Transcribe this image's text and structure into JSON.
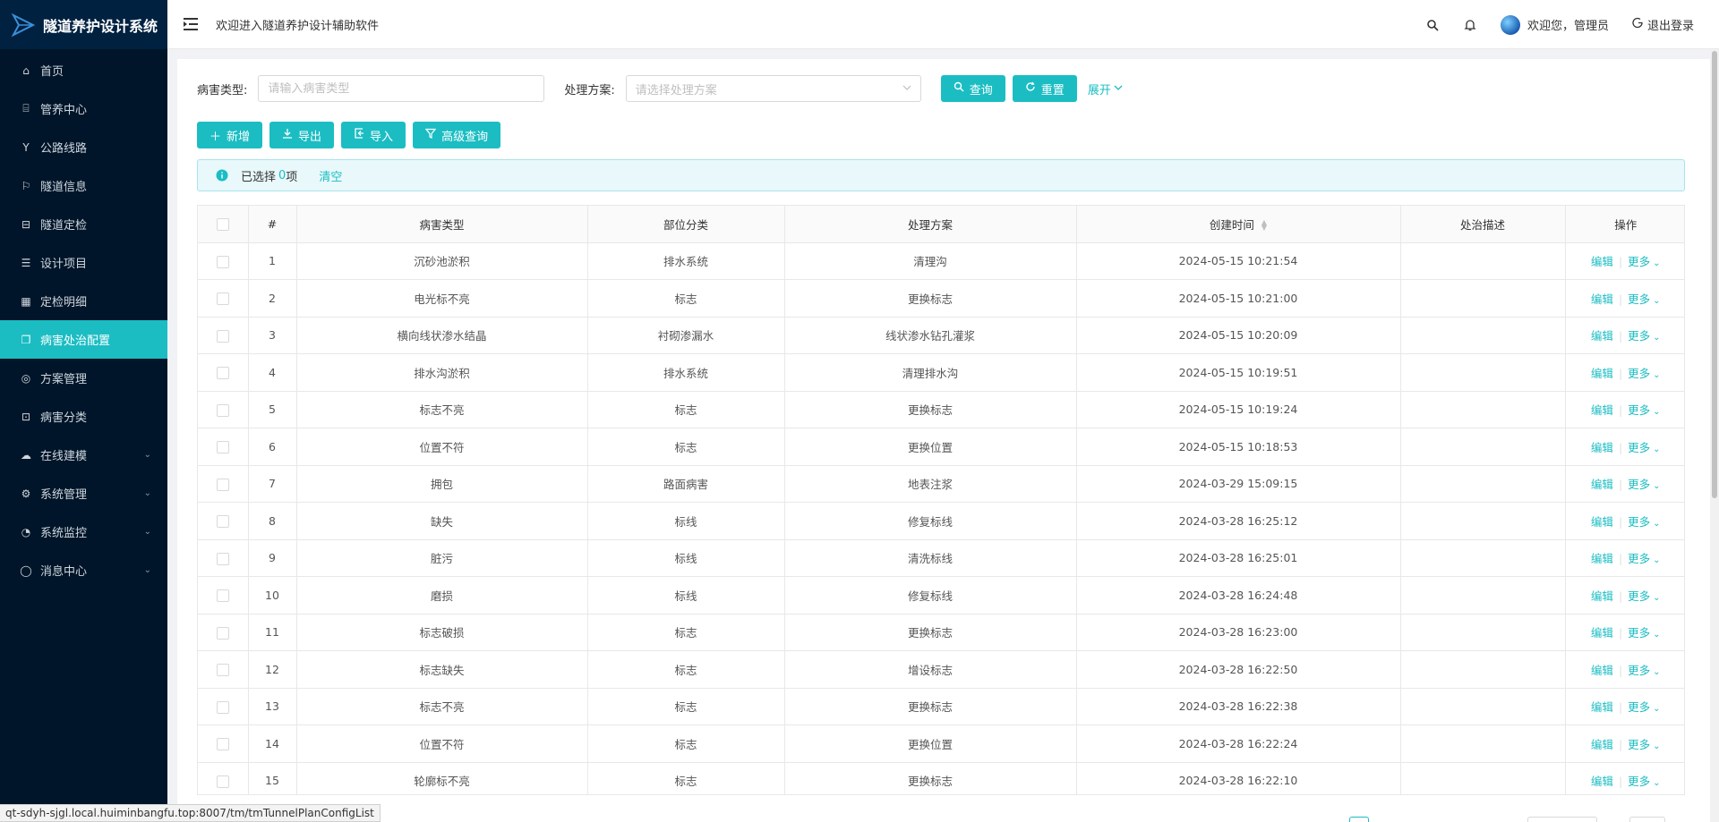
{
  "app": {
    "title": "隧道养护设计系统",
    "welcome": "欢迎进入隧道养护设计辅助软件"
  },
  "colors": {
    "accent": "#1bbdc3",
    "sidebar_bg": "#001529"
  },
  "sidebar": {
    "items": [
      {
        "label": "首页",
        "icon": "home-icon"
      },
      {
        "label": "管养中心",
        "icon": "bank-icon"
      },
      {
        "label": "公路线路",
        "icon": "fork-icon"
      },
      {
        "label": "隧道信息",
        "icon": "flag-icon"
      },
      {
        "label": "隧道定检",
        "icon": "scan-icon"
      },
      {
        "label": "设计项目",
        "icon": "list-icon"
      },
      {
        "label": "定检明细",
        "icon": "table-icon"
      },
      {
        "label": "病害处治配置",
        "icon": "copy-icon",
        "active": true
      },
      {
        "label": "方案管理",
        "icon": "compass-icon"
      },
      {
        "label": "病害分类",
        "icon": "crop-icon"
      },
      {
        "label": "在线建模",
        "icon": "cloud-icon",
        "submenu": true
      },
      {
        "label": "系统管理",
        "icon": "settings-icon",
        "submenu": true
      },
      {
        "label": "系统监控",
        "icon": "dashboard-icon",
        "submenu": true
      },
      {
        "label": "消息中心",
        "icon": "message-icon",
        "submenu": true
      }
    ]
  },
  "header": {
    "user_greeting": "欢迎您，管理员",
    "logout": "退出登录"
  },
  "filters": {
    "disease_type_label": "病害类型:",
    "disease_type_placeholder": "请输入病害类型",
    "plan_label": "处理方案:",
    "plan_placeholder": "请选择处理方案",
    "query": "查询",
    "reset": "重置",
    "expand": "展开"
  },
  "toolbar": {
    "add": "新增",
    "export": "导出",
    "import": "导入",
    "advanced": "高级查询"
  },
  "selection": {
    "prefix": "已选择",
    "count": "0",
    "suffix": "项",
    "clear": "清空"
  },
  "table": {
    "columns": [
      "#",
      "病害类型",
      "部位分类",
      "处理方案",
      "创建时间",
      "处治描述",
      "操作"
    ],
    "edit": "编辑",
    "more": "更多",
    "rows": [
      {
        "no": "1",
        "type": "沉砂池淤积",
        "part": "排水系统",
        "plan": "清理沟",
        "time": "2024-05-15 10:21:54",
        "desc": ""
      },
      {
        "no": "2",
        "type": "电光标不亮",
        "part": "标志",
        "plan": "更换标志",
        "time": "2024-05-15 10:21:00",
        "desc": ""
      },
      {
        "no": "3",
        "type": "横向线状渗水结晶",
        "part": "衬砌渗漏水",
        "plan": "线状渗水钻孔灌浆",
        "time": "2024-05-15 10:20:09",
        "desc": ""
      },
      {
        "no": "4",
        "type": "排水沟淤积",
        "part": "排水系统",
        "plan": "清理排水沟",
        "time": "2024-05-15 10:19:51",
        "desc": ""
      },
      {
        "no": "5",
        "type": "标志不亮",
        "part": "标志",
        "plan": "更换标志",
        "time": "2024-05-15 10:19:24",
        "desc": ""
      },
      {
        "no": "6",
        "type": "位置不符",
        "part": "标志",
        "plan": "更换位置",
        "time": "2024-05-15 10:18:53",
        "desc": ""
      },
      {
        "no": "7",
        "type": "拥包",
        "part": "路面病害",
        "plan": "地表注浆",
        "time": "2024-03-29 15:09:15",
        "desc": ""
      },
      {
        "no": "8",
        "type": "缺失",
        "part": "标线",
        "plan": "修复标线",
        "time": "2024-03-28 16:25:12",
        "desc": ""
      },
      {
        "no": "9",
        "type": "脏污",
        "part": "标线",
        "plan": "清洗标线",
        "time": "2024-03-28 16:25:01",
        "desc": ""
      },
      {
        "no": "10",
        "type": "磨损",
        "part": "标线",
        "plan": "修复标线",
        "time": "2024-03-28 16:24:48",
        "desc": ""
      },
      {
        "no": "11",
        "type": "标志破损",
        "part": "标志",
        "plan": "更换标志",
        "time": "2024-03-28 16:23:00",
        "desc": ""
      },
      {
        "no": "12",
        "type": "标志缺失",
        "part": "标志",
        "plan": "增设标志",
        "time": "2024-03-28 16:22:50",
        "desc": ""
      },
      {
        "no": "13",
        "type": "标志不亮",
        "part": "标志",
        "plan": "更换标志",
        "time": "2024-03-28 16:22:38",
        "desc": ""
      },
      {
        "no": "14",
        "type": "位置不符",
        "part": "标志",
        "plan": "更换位置",
        "time": "2024-03-28 16:22:24",
        "desc": ""
      },
      {
        "no": "15",
        "type": "轮廓标不亮",
        "part": "标志",
        "plan": "更换标志",
        "time": "2024-03-28 16:22:10",
        "desc": ""
      }
    ]
  },
  "statusbar": {
    "url": "qt-sdyh-sjgl.local.huiminbangfu.top:8007/tm/tmTunnelPlanConfigList"
  }
}
